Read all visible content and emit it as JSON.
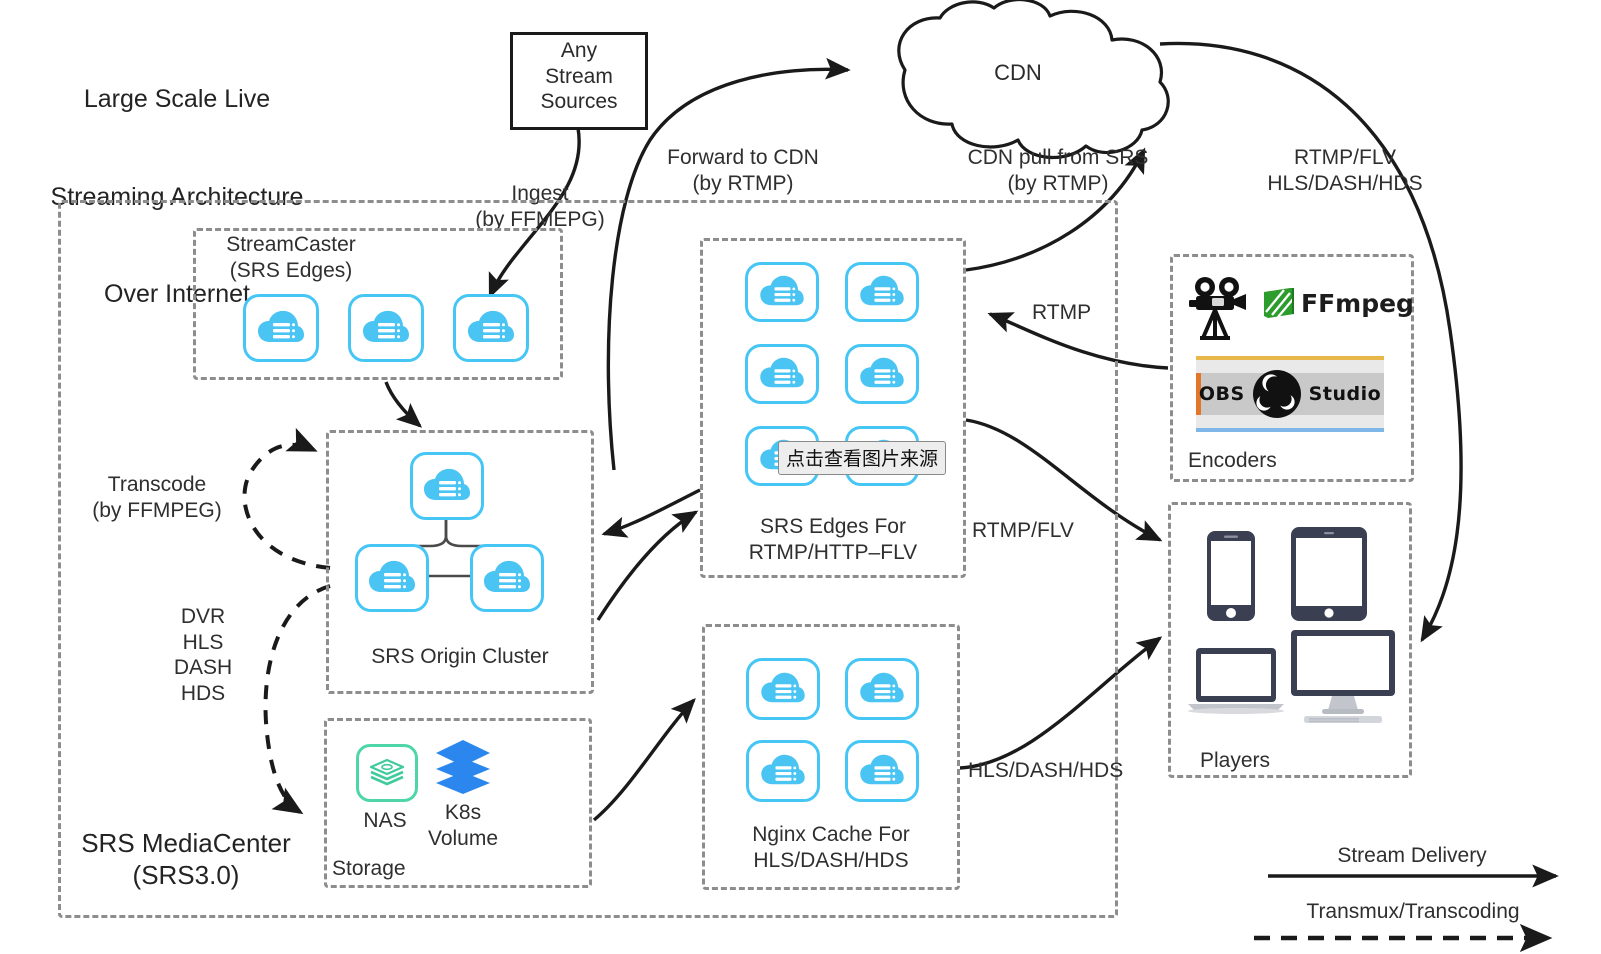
{
  "diagram": {
    "title": "Large Scale Live\nStreaming Architecture\nOver Internet",
    "title_lines": [
      "Large Scale Live",
      "Streaming Architecture",
      "Over Internet"
    ]
  },
  "nodes": {
    "any_stream_sources": "Any\nStream\nSources",
    "cdn": "CDN",
    "streamcaster": "StreamCaster\n(SRS Edges)",
    "srs_origin_cluster": "SRS Origin Cluster",
    "storage": "Storage",
    "nas": "NAS",
    "k8s_volume": "K8s\nVolume",
    "srs_edges": "SRS Edges For\nRTMP/HTTP–FLV",
    "nginx_cache": "Nginx Cache For\nHLS/DASH/HDS",
    "encoders": "Encoders",
    "players": "Players",
    "mediacenter": "SRS MediaCenter\n(SRS3.0)"
  },
  "edge_labels": {
    "ingest": "Ingest\n(by FFMEPG)",
    "forward_to_cdn": "Forward to CDN\n(by RTMP)",
    "cdn_pull": "CDN pull from SRS\n(by RTMP)",
    "rtmp_flv_hls": "RTMP/FLV\nHLS/DASH/HDS",
    "rtmp": "RTMP",
    "rtmp_flv": "RTMP/FLV",
    "hls_dash_hds": "HLS/DASH/HDS",
    "transcode": "Transcode\n(by FFMPEG)",
    "dvr_list": "DVR\nHLS\nDASH\nHDS"
  },
  "encoder_logos": {
    "ffmpeg": "FFmpeg",
    "obs_left": "OBS",
    "obs_right": "Studio"
  },
  "legend": {
    "stream_delivery": "Stream Delivery",
    "transmux": "Transmux/Transcoding"
  },
  "overlay": {
    "tooltip": "点击查看图片来源"
  },
  "colors": {
    "node_blue": "#45C6F5",
    "cloud_blue": "#4AC4F3",
    "nas_green": "#4ED6A8",
    "k8s_blue": "#2B87EE",
    "ffmpeg_green": "#2C9C2C",
    "dashed_gray": "#8d8d8d",
    "stroke_black": "#1a1a1a"
  },
  "icons": {
    "cloud_server": "cloud-server-icon",
    "nas": "nas-stack-icon",
    "k8s": "k8s-layers-icon",
    "camera": "movie-camera-icon",
    "phone": "smartphone-icon",
    "tablet": "tablet-icon",
    "laptop": "laptop-icon",
    "desktop": "desktop-monitor-icon"
  }
}
